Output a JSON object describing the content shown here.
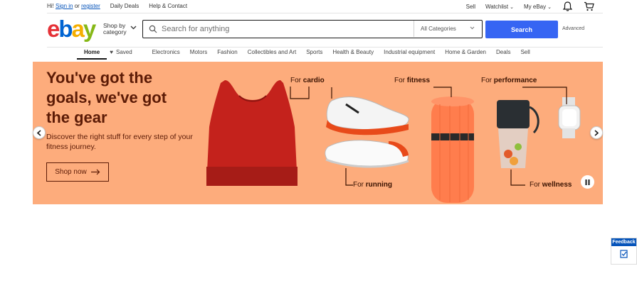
{
  "topbar": {
    "greeting": "Hi!",
    "sign_in": "Sign in",
    "or": "or",
    "register": "register",
    "daily_deals": "Daily Deals",
    "help_contact": "Help & Contact",
    "sell": "Sell",
    "watchlist": "Watchlist",
    "my_ebay": "My eBay",
    "icons": [
      "bell-icon",
      "cart-icon"
    ]
  },
  "header": {
    "logo": {
      "e": "e",
      "b": "b",
      "a": "a",
      "y": "y"
    },
    "shop_by_line1": "Shop by",
    "shop_by_line2": "category",
    "search_placeholder": "Search for anything",
    "category_select": "All Categories",
    "search_button": "Search",
    "advanced": "Advanced"
  },
  "nav": {
    "items": [
      "Home",
      "Saved",
      "Electronics",
      "Motors",
      "Fashion",
      "Collectibles and Art",
      "Sports",
      "Health & Beauty",
      "Industrial equipment",
      "Home & Garden",
      "Deals",
      "Sell"
    ]
  },
  "hero": {
    "headline_line1": "You've got the",
    "headline_line2": "goals, we've got",
    "headline_line3": "the gear",
    "subtext": "Discover the right stuff for every step of your fitness journey.",
    "cta": "Shop now",
    "labels": {
      "cardio_pre": "For ",
      "cardio": "cardio",
      "fitness_pre": "For ",
      "fitness": "fitness",
      "performance_pre": "For ",
      "performance": "performance",
      "running_pre": "For ",
      "running": "running",
      "wellness_pre": "For ",
      "wellness": "wellness"
    },
    "colors": {
      "background": "#fdac7c",
      "text": "#5c1b06"
    }
  },
  "feedback": {
    "label": "Feedback"
  },
  "colors": {
    "accent": "#3665f3",
    "link": "#0654ba"
  }
}
